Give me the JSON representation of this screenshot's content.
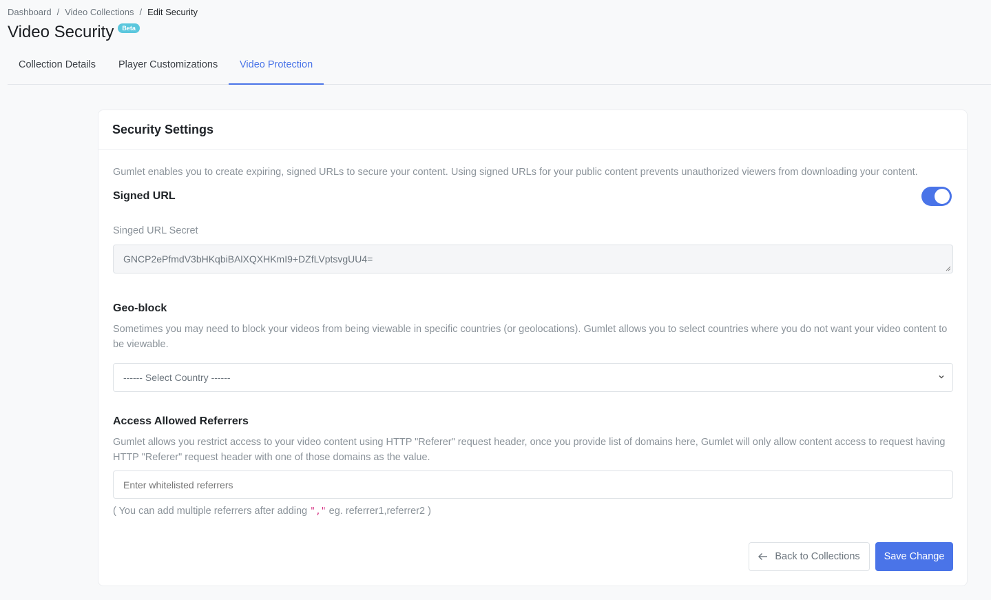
{
  "breadcrumb": {
    "items": [
      "Dashboard",
      "Video Collections"
    ],
    "current": "Edit Security",
    "separator": "/"
  },
  "page": {
    "title": "Video Security",
    "badge": "Beta"
  },
  "tabs": [
    {
      "label": "Collection Details",
      "active": false
    },
    {
      "label": "Player Customizations",
      "active": false
    },
    {
      "label": "Video Protection",
      "active": true
    }
  ],
  "card": {
    "title": "Security Settings",
    "signed_url": {
      "description": "Gumlet enables you to create expiring, signed URLs to secure your content. Using signed URLs for your public content prevents unauthorized viewers from downloading your content.",
      "title": "Signed URL",
      "enabled": true,
      "secret_label": "Singed URL Secret",
      "secret_value": "GNCP2ePfmdV3bHKqbiBAlXQXHKmI9+DZfLVptsvgUU4="
    },
    "geo_block": {
      "title": "Geo-block",
      "description": "Sometimes you may need to block your videos from being viewable in specific countries (or geolocations). Gumlet allows you to select countries where you do not want your video content to be viewable.",
      "select_placeholder": "------ Select Country ------"
    },
    "referrers": {
      "title": "Access Allowed Referrers",
      "description": "Gumlet allows you restrict access to your video content using HTTP \"Referer\" request header, once you provide list of domains here, Gumlet will only allow content access to request having HTTP \"Referer\" request header with one of those domains as the value.",
      "input_placeholder": "Enter whitelisted referrers",
      "hint_prefix": "( You can add multiple referrers after adding ",
      "hint_code": "\",\"",
      "hint_suffix": " eg. referrer1,referrer2 )"
    },
    "buttons": {
      "back_label": "Back to Collections",
      "save_label": "Save Change"
    }
  },
  "colors": {
    "accent": "#4a74e8",
    "badge": "#5bc7dd"
  }
}
